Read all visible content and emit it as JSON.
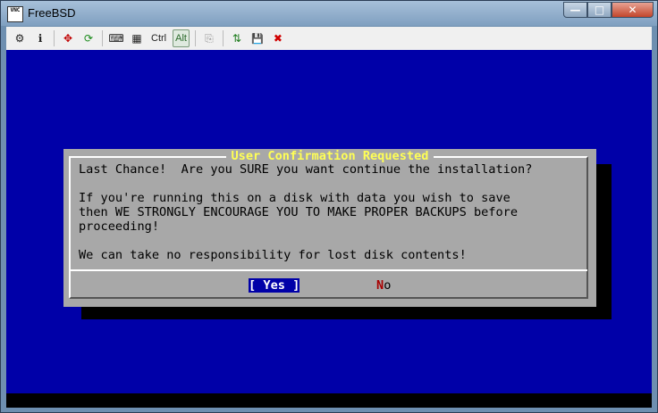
{
  "window": {
    "title": "FreeBSD",
    "app_icon_text": "VNC",
    "buttons": {
      "minimize": "—",
      "maximize": "□",
      "close": "✕"
    }
  },
  "toolbar": {
    "items": [
      {
        "name": "connection-options-icon",
        "glyph": "⚙"
      },
      {
        "name": "connection-info-icon",
        "glyph": "ℹ"
      },
      {
        "name": "full-screen-icon",
        "glyph": "✥"
      },
      {
        "name": "refresh-icon",
        "glyph": "⟳"
      },
      {
        "name": "send-ctrl-alt-del-icon",
        "glyph": "⌨"
      },
      {
        "name": "send-ctrl-esc-icon",
        "glyph": "▦"
      }
    ],
    "ctrl_label": "Ctrl",
    "alt_label": "Alt",
    "copy_glyph": "⎘",
    "transfer_glyph": "⇅",
    "save_glyph": "💾",
    "disconnect_glyph": "✖"
  },
  "dialog": {
    "title": "User Confirmation Requested",
    "lines": [
      "Last Chance!  Are you SURE you want continue the installation?",
      "",
      "If you're running this on a disk with data you wish to save",
      "then WE STRONGLY ENCOURAGE YOU TO MAKE PROPER BACKUPS before",
      "proceeding!",
      "",
      "We can take no responsibility for lost disk contents!"
    ],
    "yes": {
      "left": "[ ",
      "hotkey": "Y",
      "rest": "es ]"
    },
    "no": {
      "hotkey": "N",
      "rest": "o"
    }
  },
  "colors": {
    "console_bg": "#0000a8",
    "dialog_bg": "#a8a8a8",
    "title_text": "#ffff55",
    "hotkey_no": "#a80000"
  }
}
